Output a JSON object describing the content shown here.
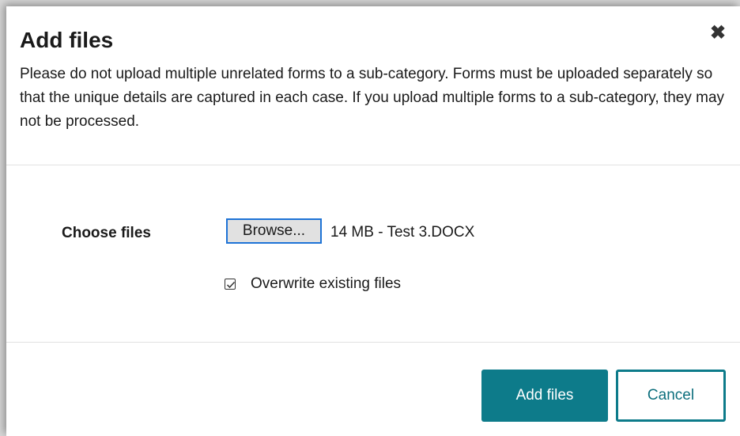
{
  "dialog": {
    "title": "Add files",
    "close_icon": "close-icon",
    "close_glyph": "✖",
    "description": "Please do not upload multiple unrelated forms to a sub-category. Forms must be uploaded separately so that the unique details are captured in each case. If you upload multiple forms to a sub-category, they may not be processed."
  },
  "form": {
    "choose_label": "Choose files",
    "browse_label": "Browse...",
    "selected_file": "14 MB - Test 3.DOCX",
    "overwrite_label": "Overwrite existing files",
    "overwrite_checked": true
  },
  "footer": {
    "add_label": "Add files",
    "cancel_label": "Cancel"
  },
  "colors": {
    "accent": "#0d7b8a",
    "browse_border": "#1e73d6"
  }
}
